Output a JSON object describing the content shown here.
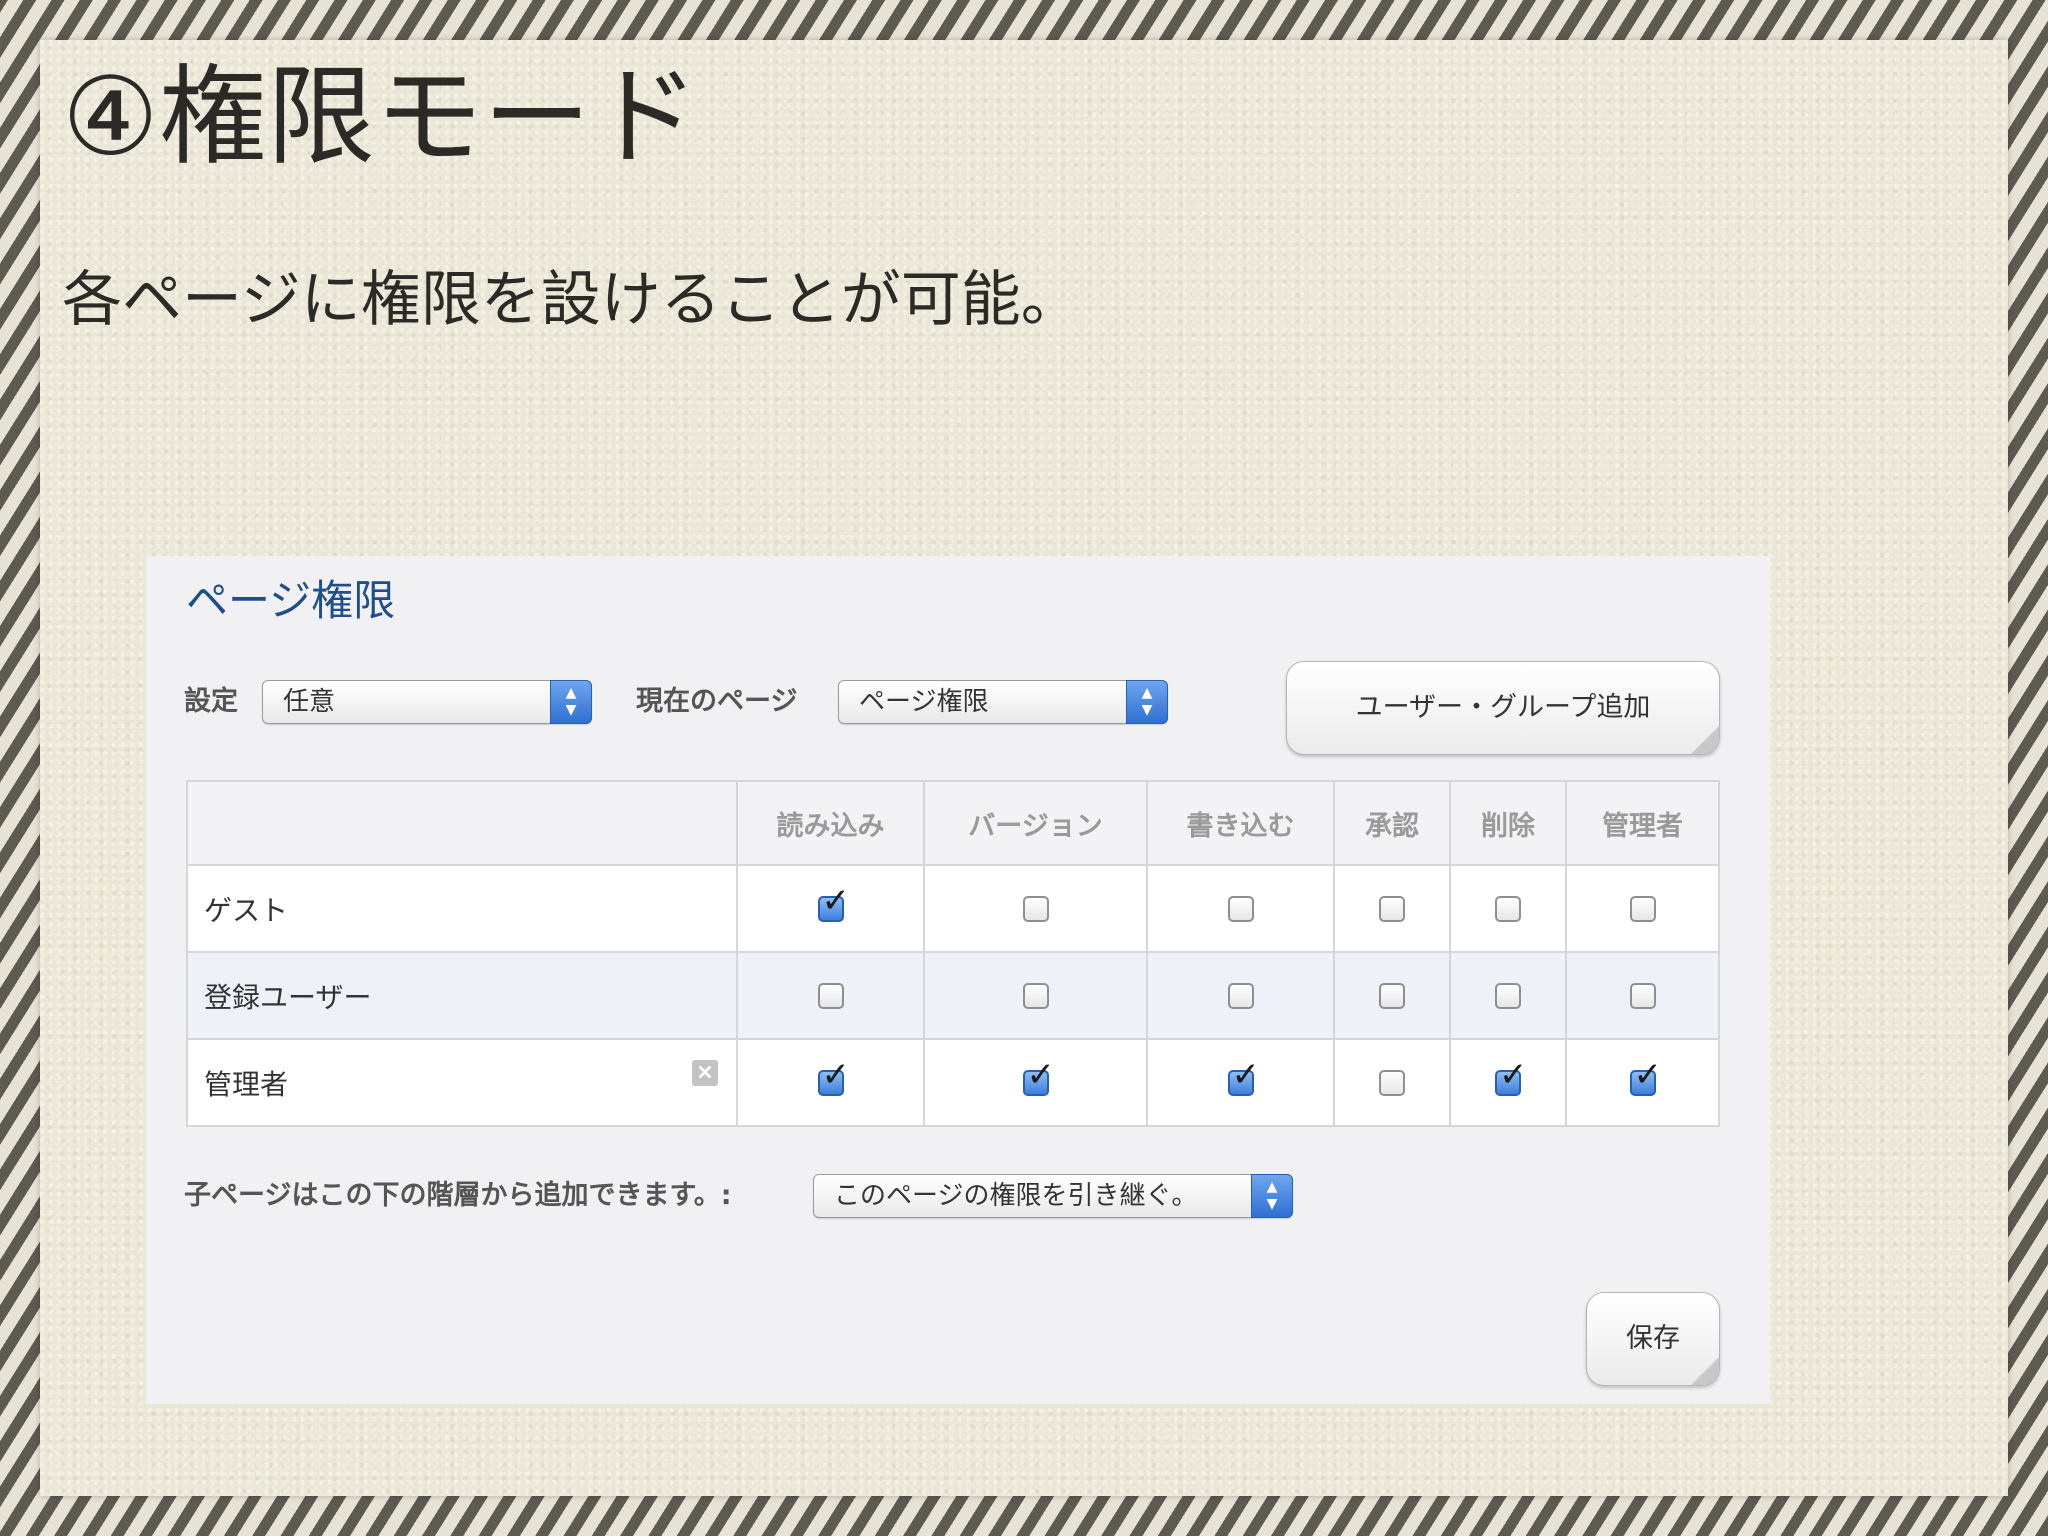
{
  "slide": {
    "title": "④権限モード",
    "subtitle": "各ページに権限を設けることが可能。"
  },
  "panel": {
    "heading": "ページ権限",
    "setting_label": "設定",
    "setting_value": "任意",
    "current_page_label": "現在のページ",
    "current_page_value": "ページ権限",
    "add_user_group_button": "ユーザー・グループ追加",
    "child_pages_label": "子ページはこの下の階層から追加できます。:",
    "child_pages_value": "このページの権限を引き継ぐ。",
    "save_button": "保存"
  },
  "table": {
    "columns": [
      "読み込み",
      "バージョン",
      "書き込む",
      "承認",
      "削除",
      "管理者"
    ],
    "rows": [
      {
        "role": "ゲスト",
        "perms": [
          true,
          false,
          false,
          false,
          false,
          false
        ],
        "removable": false
      },
      {
        "role": "登録ユーザー",
        "perms": [
          false,
          false,
          false,
          false,
          false,
          false
        ],
        "removable": false
      },
      {
        "role": "管理者",
        "perms": [
          true,
          true,
          true,
          false,
          true,
          true
        ],
        "removable": true
      }
    ]
  },
  "colors": {
    "heading": "#1f4e8c",
    "select_arrow": "#3d7fdc",
    "alt_row": "#eef1f8"
  }
}
